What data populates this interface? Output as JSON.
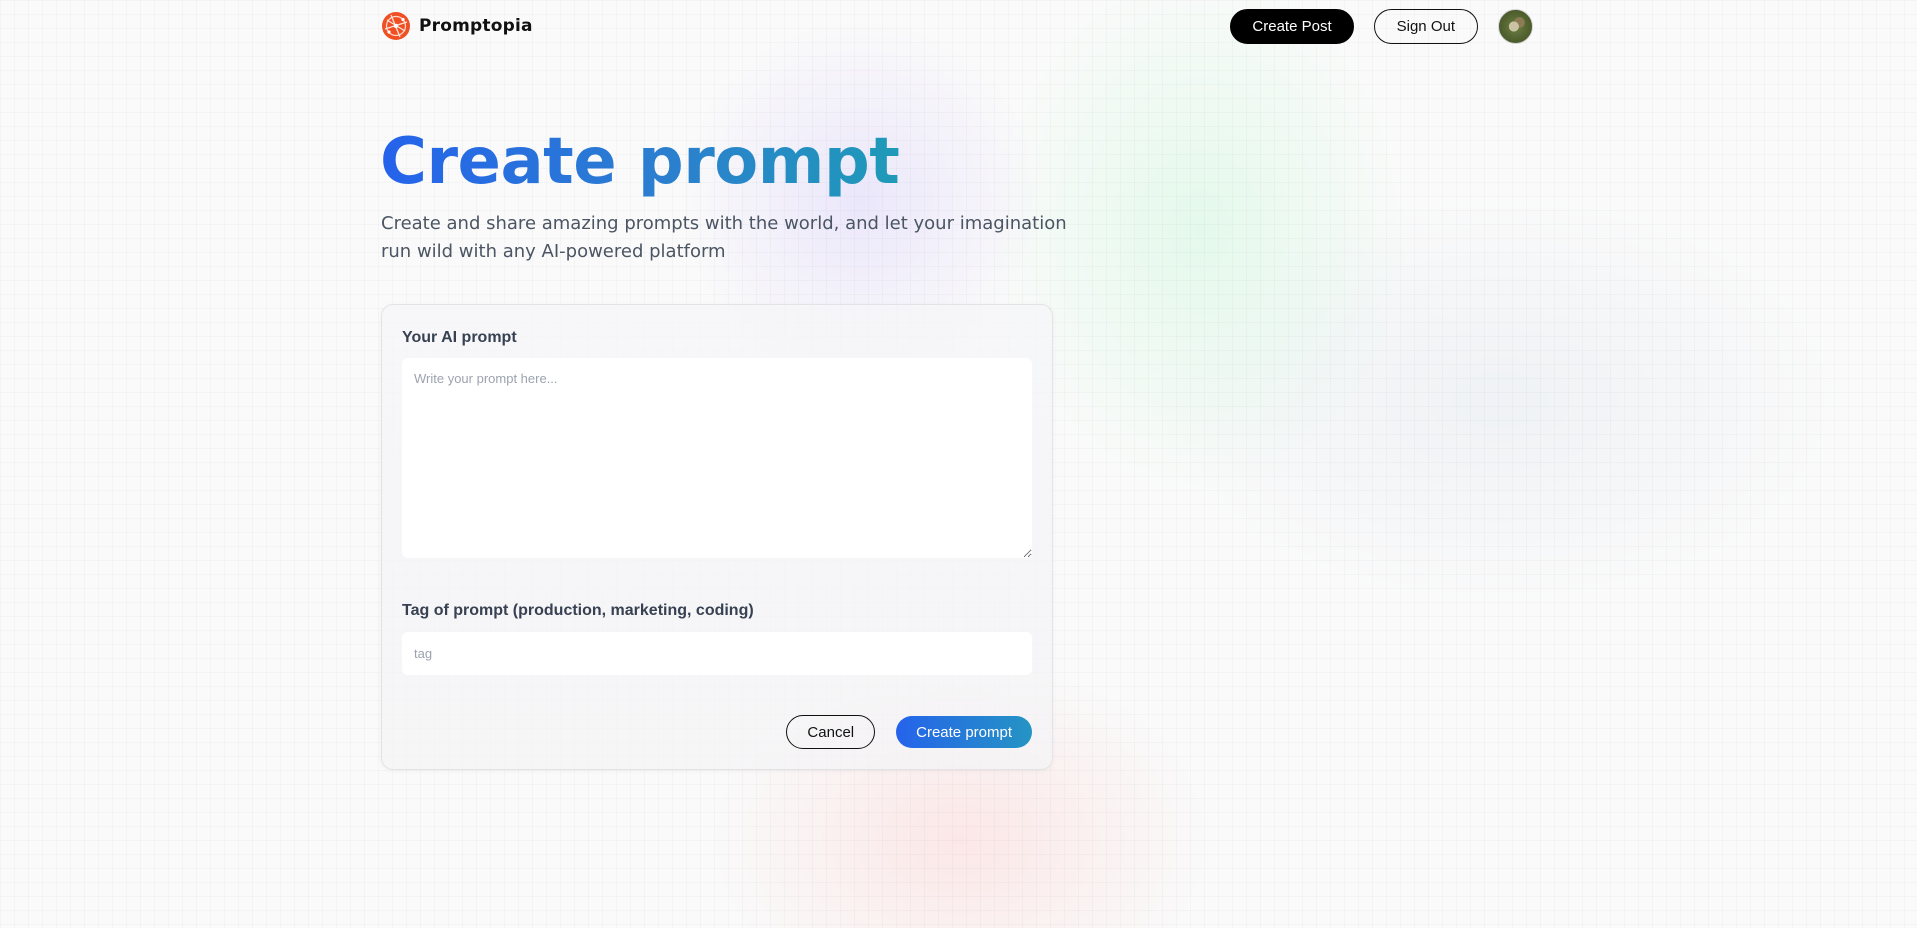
{
  "app": {
    "brand_name": "Promptopia",
    "brand_color": "#f04e23"
  },
  "nav": {
    "create_post_label": "Create Post",
    "sign_out_label": "Sign Out",
    "avatar_icon": "user-avatar"
  },
  "hero": {
    "title": "Create prompt",
    "description": "Create and share amazing prompts with the world, and let your imagination run wild with any AI-powered platform"
  },
  "form": {
    "prompt_label": "Your AI prompt",
    "prompt_placeholder": "Write your prompt here...",
    "prompt_value": "",
    "tag_label": "Tag of prompt (production, marketing, coding)",
    "tag_placeholder": "tag",
    "tag_value": "",
    "cancel_label": "Cancel",
    "submit_label": "Create prompt"
  },
  "colors": {
    "title_gradient_start": "#2563eb",
    "title_gradient_end": "#1f9ab8",
    "primary_button": "#000000"
  }
}
